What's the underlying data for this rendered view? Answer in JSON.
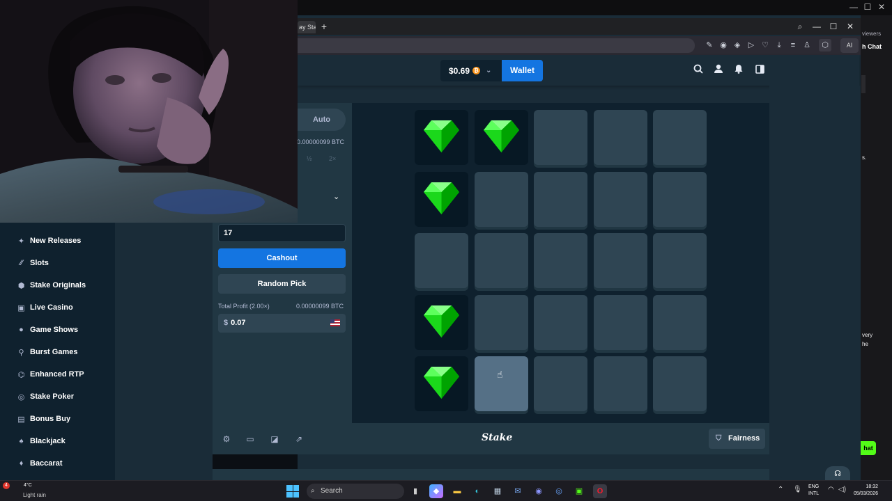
{
  "os": {
    "minimize": "—",
    "maximize": "☐",
    "close": "✕"
  },
  "browser": {
    "tab_label": "ay Sta",
    "new_tab": "+",
    "search_icon": "⌕",
    "min": "—",
    "max": "☐",
    "close": "✕",
    "ai_label": "AI",
    "tools": [
      "✎",
      "◉",
      "◈",
      "▷",
      "♡",
      "⤓",
      "≡",
      "♙",
      "⬡"
    ]
  },
  "header": {
    "balance": "$0.69",
    "currency_glyph": "₿",
    "wallet_label": "Wallet",
    "icons": [
      "search-icon",
      "user-icon",
      "bell-icon",
      "sidebar-toggle-icon"
    ]
  },
  "sidebar": {
    "items": [
      {
        "label": "New Releases",
        "icon": "✦"
      },
      {
        "label": "Slots",
        "icon": "⁄⁄"
      },
      {
        "label": "Stake Originals",
        "icon": "⬢"
      },
      {
        "label": "Live Casino",
        "icon": "▣"
      },
      {
        "label": "Game Shows",
        "icon": "●"
      },
      {
        "label": "Burst Games",
        "icon": "⚲"
      },
      {
        "label": "Enhanced RTP",
        "icon": "⌬"
      },
      {
        "label": "Stake Poker",
        "icon": "◎"
      },
      {
        "label": "Bonus Buy",
        "icon": "▤"
      },
      {
        "label": "Blackjack",
        "icon": "♠"
      },
      {
        "label": "Baccarat",
        "icon": "♦"
      }
    ]
  },
  "controls": {
    "auto_tab": "Auto",
    "bet_btc": "0.00000099 BTC",
    "half": "½",
    "double": "2×",
    "gems_value": "17",
    "cashout_label": "Cashout",
    "random_pick_label": "Random Pick",
    "profit_label": "Total Profit (2.00×)",
    "profit_btc": "0.00000099 BTC",
    "profit_currency": "$",
    "profit_value": "0.07"
  },
  "grid": {
    "rows": 5,
    "cols": 5,
    "gems": [
      [
        0,
        0
      ],
      [
        0,
        1
      ],
      [
        1,
        0
      ],
      [
        3,
        0
      ],
      [
        4,
        0
      ]
    ],
    "hover": [
      4,
      1
    ],
    "colors": {
      "gem": "#00e701",
      "gem_dark": "#00a301",
      "tile": "#2f4553",
      "revealed": "#071824"
    }
  },
  "footer": {
    "logo": "Stake",
    "fairness_label": "Fairness"
  },
  "chat": {
    "viewers": "viewers",
    "title": "h Chat",
    "msg1": "s.",
    "msg2": "very",
    "msg3": "he",
    "chat_btn": "hat"
  },
  "taskbar": {
    "weather_temp": "4°C",
    "weather_cond": "Light rain",
    "weather_badge": "4",
    "search_placeholder": "Search",
    "lang1": "ENG",
    "lang2": "INTL",
    "time": "18:32",
    "date": "05/03/2026"
  }
}
